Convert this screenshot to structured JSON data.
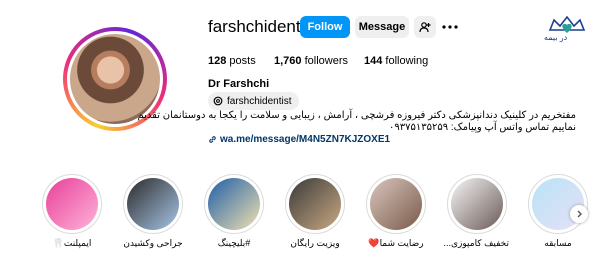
{
  "brand": {
    "logo_text": "در بیمه",
    "logo_icon": "crown-heart-logo"
  },
  "profile": {
    "username": "farshchidentist",
    "full_name": "Dr Farshchi",
    "threads_handle": "farshchidentist",
    "posts_count": "128",
    "posts_label": "posts",
    "followers_count": "1,760",
    "followers_label": "followers",
    "following_count": "144",
    "following_label": "following",
    "bio_line1": "مفتخریم در کلینیک دندانپزشکی دکتر فیروزه فرشچی ، آرامش ، زیبایی و سلامت را یکجا به دوستانمان تقدیم",
    "bio_line2": "نماییم تماس واتس آپ وپیامک: ۰۹۳۷۵۱۳۵۲۵۹",
    "link": "wa.me/message/M4N5ZN7KJZOXE1"
  },
  "actions": {
    "follow_label": "Follow",
    "message_label": "Message",
    "add_user_icon": "add-user-icon",
    "more_icon": "more-options-icon"
  },
  "colors": {
    "follow": "#0095f6",
    "link": "#00376b",
    "secondary_button": "#efefef"
  },
  "highlights": [
    {
      "label": "ایمپلنت🦷",
      "colors": [
        "#e8409a",
        "#ffb3d9"
      ]
    },
    {
      "label": "جراحی وکشیدن",
      "colors": [
        "#2b2b2b",
        "#a7c5e6"
      ]
    },
    {
      "label": "#بلیچینگ",
      "colors": [
        "#1f5fa8",
        "#f0e0b0"
      ]
    },
    {
      "label": "ویزیت رایگان",
      "colors": [
        "#3a3a3a",
        "#c9a982"
      ]
    },
    {
      "label": "رضایت شما❤️",
      "colors": [
        "#d9c6bd",
        "#7a5a4a"
      ]
    },
    {
      "label": "تخفیف کامپوزی...",
      "colors": [
        "#f6f6f6",
        "#6a5a55"
      ]
    },
    {
      "label": "مسابقه",
      "colors": [
        "#b9e3f7",
        "#e6e0f5"
      ]
    }
  ]
}
